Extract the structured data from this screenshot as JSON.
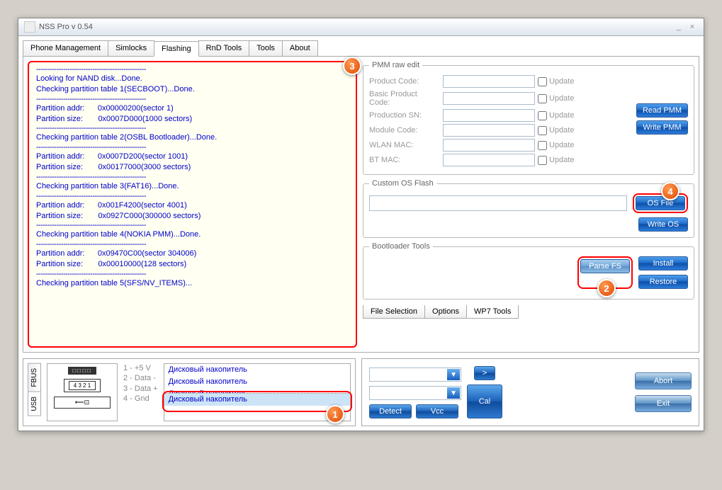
{
  "title": "NSS Pro v 0.54",
  "tabs": {
    "phone_mgmt": "Phone Management",
    "simlocks": "Simlocks",
    "flashing": "Flashing",
    "rnd": "RnD Tools",
    "tools": "Tools",
    "about": "About"
  },
  "log": {
    "dash": "-------------------------------------------------",
    "l1": "Looking for NAND disk...Done.",
    "l2": "Checking partition table 1(SECBOOT)...Done.",
    "l3a": "Partition addr:",
    "l3b": "0x00000200(sector 1)",
    "l4a": "Partition size:",
    "l4b": "0x0007D000(1000 sectors)",
    "l5": "Checking partition table 2(OSBL Bootloader)...Done.",
    "l6a": "Partition addr:",
    "l6b": "0x0007D200(sector 1001)",
    "l7a": "Partition size:",
    "l7b": "0x00177000(3000 sectors)",
    "l8": "Checking partition table 3(FAT16)...Done.",
    "l9a": "Partition addr:",
    "l9b": "0x001F4200(sector 4001)",
    "l10a": "Partition size:",
    "l10b": "0x0927C000(300000 sectors)",
    "l11": "Checking partition table 4(NOKIA PMM)...Done.",
    "l12a": "Partition addr:",
    "l12b": "0x09470C00(sector 304006)",
    "l13a": "Partition size:",
    "l13b": "0x00010000(128 sectors)",
    "l14": "Checking partition table 5(SFS/NV_ITEMS)..."
  },
  "pmm": {
    "legend": "PMM raw edit",
    "product_code": "Product Code:",
    "basic_product_code": "Basic Product Code:",
    "production_sn": "Production SN:",
    "module_code": "Module Code:",
    "wlan_mac": "WLAN MAC:",
    "bt_mac": "BT MAC:",
    "update": "Update",
    "read_pmm": "Read PMM",
    "write_pmm": "Write PMM"
  },
  "customos": {
    "legend": "Custom OS Flash",
    "os_file": "OS File",
    "write_os": "Write OS"
  },
  "bootloader": {
    "legend": "Bootloader Tools",
    "parse_fs": "Parse FS",
    "install": "Install",
    "restore": "Restore"
  },
  "subtabs": {
    "file_sel": "File Selection",
    "options": "Options",
    "wp7": "WP7 Tools"
  },
  "pins": {
    "p1": "1 - +5 V",
    "p2": "2 - Data -",
    "p3": "3 - Data +",
    "p4": "4 - Gnd"
  },
  "port": {
    "fbus": "FBUS",
    "usb": "USB",
    "pinbar": "□□□□",
    "nums": "4 3 2 1",
    "plug": "⟵⊡"
  },
  "disks": {
    "d1": "Дисковый накопитель",
    "d2": "Дисковый накопитель",
    "d3": "Дисковый накопитель",
    "d4": "Дисковый накопитель"
  },
  "controls": {
    "detect": "Detect",
    "vcc": "Vcc",
    "cal": "Cal",
    "arrow": ">",
    "abort": "Abort",
    "exit": "Exit"
  },
  "callouts": {
    "c1": "1",
    "c2": "2",
    "c3": "3",
    "c4": "4"
  }
}
